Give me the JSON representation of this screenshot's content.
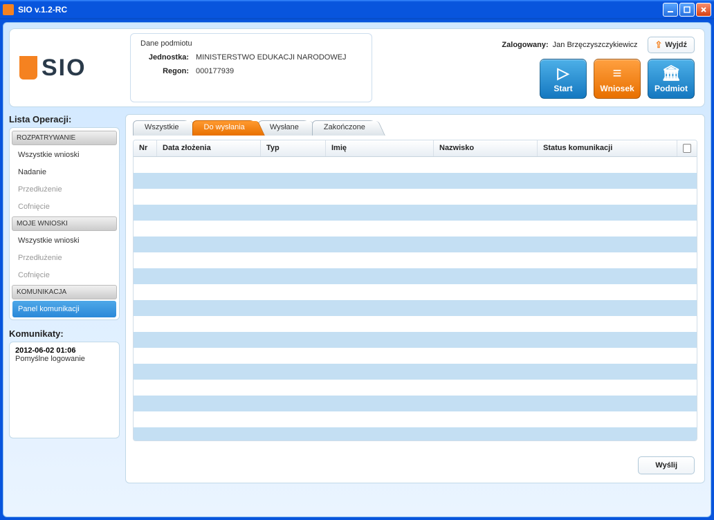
{
  "window": {
    "title": "SIO v.1.2-RC"
  },
  "logo_text": "SIO",
  "entity": {
    "header": "Dane podmiotu",
    "unit_label": "Jednostka:",
    "unit_value": "MINISTERSTWO EDUKACJI NARODOWEJ",
    "regon_label": "Regon:",
    "regon_value": "000177939"
  },
  "session": {
    "logged_label": "Zalogowany:",
    "user_name": "Jan Brzęczyszczykiewicz",
    "logout_label": "Wyjdź"
  },
  "big_buttons": {
    "start": "Start",
    "wniosek": "Wniosek",
    "podmiot": "Podmiot"
  },
  "sidebar": {
    "title": "Lista Operacji:",
    "groups": [
      {
        "header": "ROZPATRYWANIE",
        "items": [
          {
            "label": "Wszystkie wnioski",
            "dim": false
          },
          {
            "label": "Nadanie",
            "dim": false
          },
          {
            "label": "Przedłużenie",
            "dim": true
          },
          {
            "label": "Cofnięcie",
            "dim": true
          }
        ]
      },
      {
        "header": "MOJE WNIOSKI",
        "items": [
          {
            "label": "Wszystkie wnioski",
            "dim": false
          },
          {
            "label": "Przedłużenie",
            "dim": true
          },
          {
            "label": "Cofnięcie",
            "dim": true
          }
        ]
      },
      {
        "header": "KOMUNIKACJA",
        "items": [
          {
            "label": "Panel komunikacji",
            "active": true
          }
        ]
      }
    ]
  },
  "messages": {
    "title": "Komunikaty:",
    "entries": [
      {
        "time": "2012-06-02 01:06",
        "body": "Pomyślne logowanie"
      }
    ]
  },
  "tabs": {
    "items": [
      {
        "label": "Wszystkie",
        "active": false
      },
      {
        "label": "Do wysłania",
        "active": true
      },
      {
        "label": "Wysłane",
        "active": false
      },
      {
        "label": "Zakończone",
        "active": false
      }
    ]
  },
  "table": {
    "columns": {
      "nr": "Nr",
      "data": "Data złożenia",
      "typ": "Typ",
      "imie": "Imię",
      "nazwisko": "Nazwisko",
      "status": "Status komunikacji"
    },
    "rows": []
  },
  "send_button": "Wyślij"
}
